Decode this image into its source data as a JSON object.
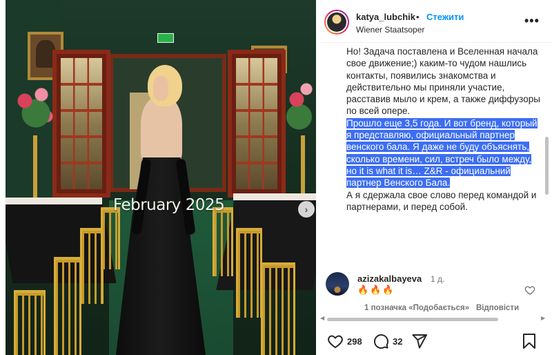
{
  "post": {
    "username": "katya_lubchik",
    "separator": "•",
    "follow_label": "Стежити",
    "location": "Wiener Staatsoper",
    "more_label": "•••"
  },
  "photo": {
    "caption": "February 2025",
    "next_label": "›"
  },
  "caption": {
    "para1": "Но! Задача поставлена и Вселенная начала свое движение;) каким-то чудом нашлись контакты, появились знакомства и действительно мы приняли участие, расставив мыло и крем, а также диффузоры по всей опере.",
    "para2": "Прошло еще 3,5 года. И вот бренд, который я представляю, официальный партнер венского бала. Я даже не буду объяснять, сколько времени, сил, встреч было между, но it is what it is… Z&R - официальний партнер Венского Бала.",
    "para3": "А я сдержала свое слово перед командой и партнерами, и перед собой."
  },
  "comment": {
    "username": "azizakalbayeva",
    "time": "1 д.",
    "text": "🔥🔥🔥",
    "likes": "1 позначка «Подобається»",
    "reply": "Відповісти"
  },
  "actions": {
    "likes": "298",
    "comments": "32"
  },
  "colors": {
    "accent": "#0095f6",
    "highlight": "#3d6ef2"
  },
  "icons": [
    "more-icon",
    "heart-icon",
    "comment-icon",
    "share-icon",
    "bookmark-icon",
    "chevron-right-icon",
    "fire-icon"
  ]
}
